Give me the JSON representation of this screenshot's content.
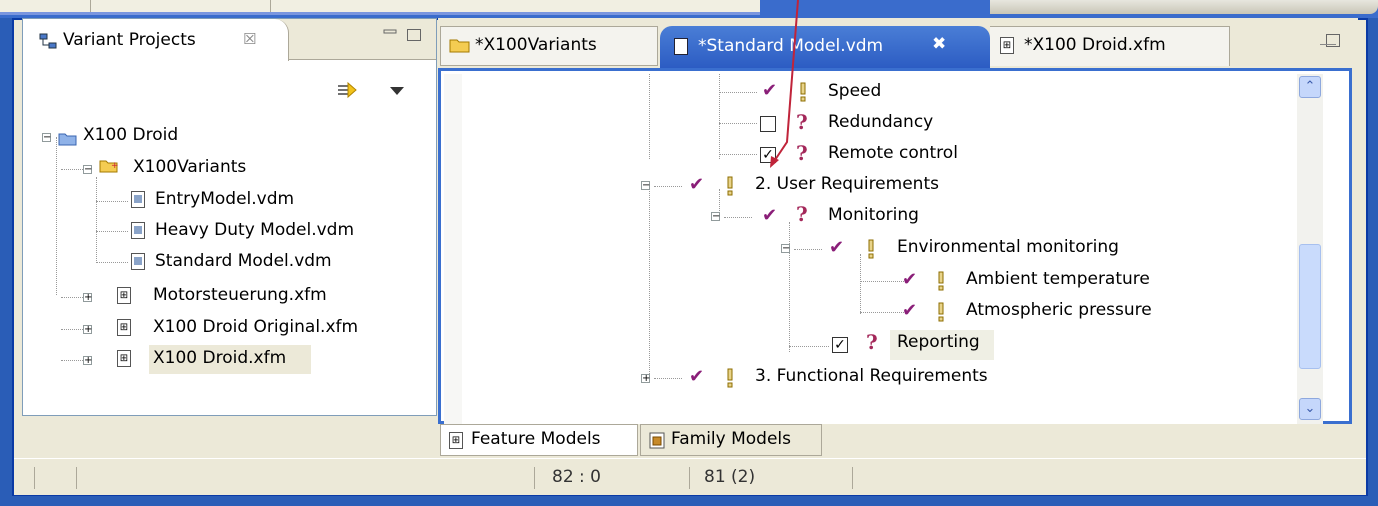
{
  "left_view": {
    "tab_label": "Variant Projects",
    "close_glyph": "☒",
    "tree": {
      "root": "X100 Droid",
      "variants_folder": "X100Variants",
      "vdm_files": [
        "EntryModel.vdm",
        "Heavy Duty Model.vdm",
        "Standard Model.vdm"
      ],
      "xfm_files": [
        "Motorsteuerung.xfm",
        "X100 Droid Original.xfm",
        "X100 Droid.xfm"
      ]
    }
  },
  "editor": {
    "tabs": [
      "*X100Variants",
      "*Standard Model.vdm",
      "*X100 Droid.xfm"
    ],
    "active_tab_close": "✖",
    "features": {
      "speed": "Speed",
      "redundancy": "Redundancy",
      "remote_control": "Remote control",
      "user_req": "2. User Requirements",
      "monitoring": "Monitoring",
      "env_monitoring": "Environmental monitoring",
      "ambient_temp": "Ambient temperature",
      "atmospheric_pressure": "Atmospheric pressure",
      "reporting": "Reporting",
      "functional_req": "3. Functional Requirements"
    },
    "bottom_tabs": [
      "Feature Models",
      "Family Models"
    ]
  },
  "status_bar": {
    "position": "82 : 0",
    "count": "81 (2)"
  },
  "colors": {
    "frame": "#0a3aa5",
    "active_tab": "#2c5cc3",
    "check": "#8a1e78",
    "annotation": "#c0243a"
  }
}
